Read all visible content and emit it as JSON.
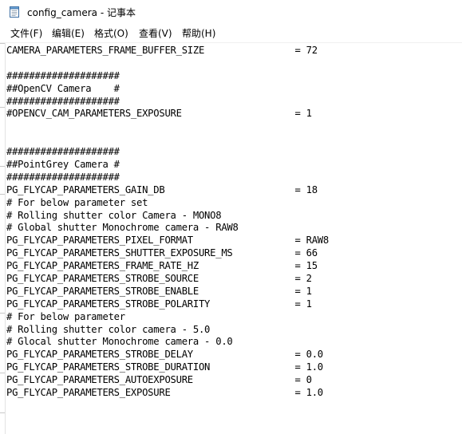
{
  "window": {
    "title": "config_camera - 记事本",
    "icon": "notepad-icon"
  },
  "menu": [
    {
      "label": "文件(F)"
    },
    {
      "label": "编辑(E)"
    },
    {
      "label": "格式(O)"
    },
    {
      "label": "查看(V)"
    },
    {
      "label": "帮助(H)"
    }
  ],
  "document": {
    "lines": [
      "CAMERA_PARAMETERS_FRAME_BUFFER_SIZE                = 72",
      "",
      "####################",
      "##OpenCV Camera    #",
      "####################",
      "#OPENCV_CAM_PARAMETERS_EXPOSURE                    = 1",
      "",
      "",
      "####################",
      "##PointGrey Camera #",
      "####################",
      "PG_FLYCAP_PARAMETERS_GAIN_DB                       = 18",
      "# For below parameter set",
      "# Rolling shutter color Camera - MONO8",
      "# Global shutter Monochrome camera - RAW8",
      "PG_FLYCAP_PARAMETERS_PIXEL_FORMAT                  = RAW8",
      "PG_FLYCAP_PARAMETERS_SHUTTER_EXPOSURE_MS           = 66",
      "PG_FLYCAP_PARAMETERS_FRAME_RATE_HZ                 = 15",
      "PG_FLYCAP_PARAMETERS_STROBE_SOURCE                 = 2",
      "PG_FLYCAP_PARAMETERS_STROBE_ENABLE                 = 1",
      "PG_FLYCAP_PARAMETERS_STROBE_POLARITY               = 1",
      "# For below parameter",
      "# Rolling shutter color camera - 5.0",
      "# Glocal shutter Monochrome camera - 0.0",
      "PG_FLYCAP_PARAMETERS_STROBE_DELAY                  = 0.0",
      "PG_FLYCAP_PARAMETERS_STROBE_DURATION               = 1.0",
      "PG_FLYCAP_PARAMETERS_AUTOEXPOSURE                  = 0",
      "PG_FLYCAP_PARAMETERS_EXPOSURE                      = 1.0",
      "",
      ""
    ]
  }
}
